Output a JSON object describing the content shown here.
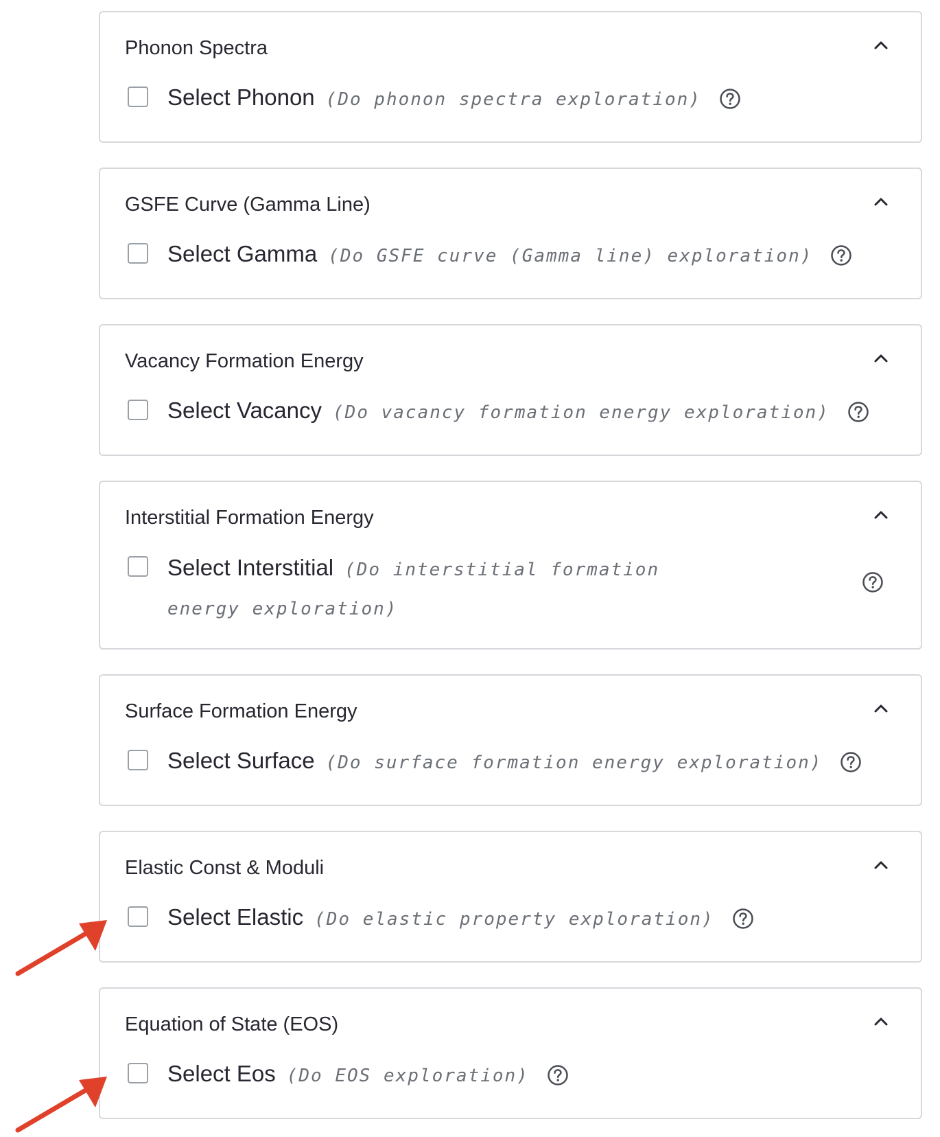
{
  "colors": {
    "border": "#d6d8dc",
    "title_text": "#262730",
    "description_text": "#6b6f76",
    "icon": "#4a4d55",
    "annotation_arrow": "#e0412a"
  },
  "panels": [
    {
      "title": "Phonon Spectra",
      "option_label": "Select Phonon",
      "option_description": "(Do phonon spectra exploration)",
      "checked": false,
      "expanded": true
    },
    {
      "title": "GSFE Curve (Gamma Line)",
      "option_label": "Select Gamma",
      "option_description": "(Do GSFE curve (Gamma line) exploration)",
      "checked": false,
      "expanded": true
    },
    {
      "title": "Vacancy Formation Energy",
      "option_label": "Select Vacancy",
      "option_description": "(Do vacancy formation energy exploration)",
      "checked": false,
      "expanded": true
    },
    {
      "title": "Interstitial Formation Energy",
      "option_label": "Select Interstitial",
      "option_description": "(Do interstitial formation energy exploration)",
      "checked": false,
      "expanded": true
    },
    {
      "title": "Surface Formation Energy",
      "option_label": "Select Surface",
      "option_description": "(Do surface formation energy exploration)",
      "checked": false,
      "expanded": true
    },
    {
      "title": "Elastic Const & Moduli",
      "option_label": "Select Elastic",
      "option_description": "(Do elastic property exploration)",
      "checked": false,
      "expanded": true
    },
    {
      "title": "Equation of State (EOS)",
      "option_label": "Select Eos",
      "option_description": "(Do EOS exploration)",
      "checked": false,
      "expanded": true
    }
  ],
  "icons": {
    "collapse": "chevron-up-icon",
    "help": "help-circle-icon",
    "annotation": "red-arrow-icon"
  }
}
